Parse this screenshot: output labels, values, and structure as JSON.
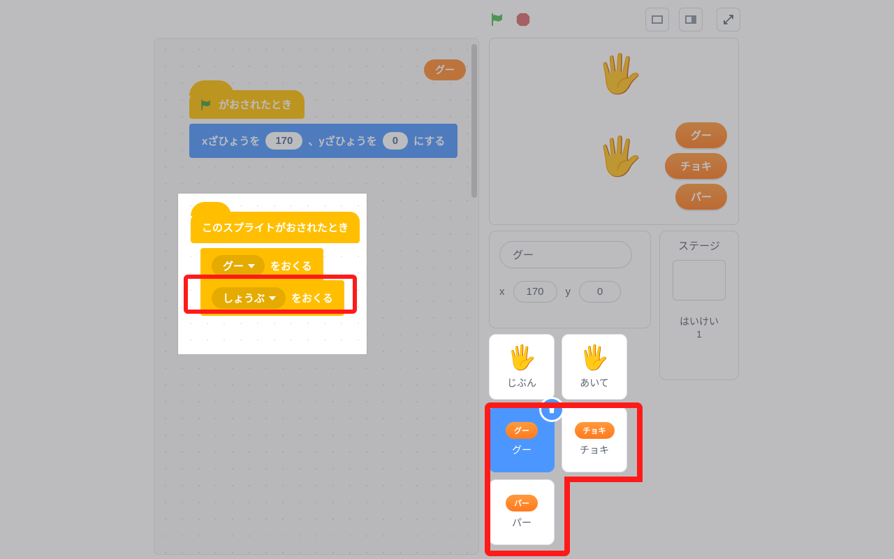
{
  "controls": {
    "view_small": "small",
    "view_large": "large",
    "view_full": "fullscreen"
  },
  "script": {
    "mini_tag": "グー",
    "hat_flag_label": "がおされたとき",
    "motion": {
      "prefix": "xざひょうを",
      "x": "170",
      "mid": "、yざひょうを",
      "y": "0",
      "suffix": "にする"
    },
    "hat_sprite_label": "このスプライトがおされたとき",
    "broadcast1": {
      "option": "グー",
      "suffix": "をおくる"
    },
    "broadcast2": {
      "option": "しょうぶ",
      "suffix": "をおくる"
    }
  },
  "stage": {
    "buttons": [
      "グー",
      "チョキ",
      "パー"
    ]
  },
  "sprite_info": {
    "name": "グー",
    "x_label": "x",
    "x": "170",
    "y_label": "y",
    "y": "0"
  },
  "stage_panel": {
    "title": "ステージ",
    "backdrops_label": "はいけい",
    "backdrops_count": "1"
  },
  "sprites": {
    "items": [
      {
        "label": "じぶん"
      },
      {
        "label": "あいて"
      },
      {
        "label": "グー",
        "tag": "グー"
      },
      {
        "label": "チョキ",
        "tag": "チョキ"
      },
      {
        "label": "パー",
        "tag": "パー"
      }
    ]
  }
}
